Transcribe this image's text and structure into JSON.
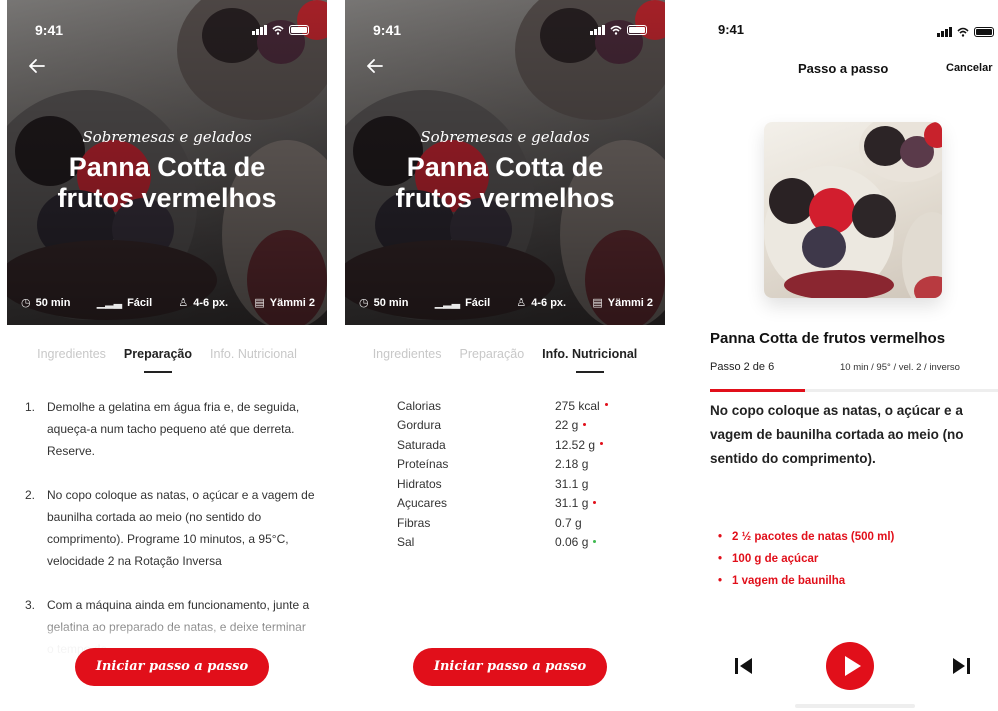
{
  "status": {
    "time": "9:41"
  },
  "recipe": {
    "category": "Sobremesas e gelados",
    "title": "Panna Cotta de frutos vermelhos",
    "title_line1": "Panna Cotta de",
    "title_line2": "frutos vermelhos",
    "meta": {
      "time": "50 min",
      "difficulty": "Fácil",
      "portions": "4-6 px.",
      "device": "Yämmi 2"
    }
  },
  "tabs": {
    "ingredients": "Ingredientes",
    "preparation": "Preparação",
    "nutrition": "Info. Nutricional"
  },
  "preparation_steps": [
    {
      "num": "1.",
      "text": "Demolhe a gelatina em água fria e, de seguida, aqueça-a num tacho pequeno até que derreta. Reserve."
    },
    {
      "num": "2.",
      "text": "No copo coloque as natas, o açúcar e a vagem de baunilha cortada ao meio (no sentido do comprimento). Programe 10 minutos, a 95°C, velocidade 2 na Rotação Inversa"
    },
    {
      "num": "3.",
      "text": "Com a máquina ainda em funcionamento, junte a gelatina ao preparado de natas, e deixe terminar o tempo de"
    }
  ],
  "nutrition": [
    {
      "label": "Calorias",
      "value": "275 kcal",
      "dot": "#e10f1a"
    },
    {
      "label": "Gordura",
      "value": "22 g",
      "dot": "#e10f1a"
    },
    {
      "label": "Saturada",
      "value": "12.52 g",
      "dot": "#e10f1a"
    },
    {
      "label": "Proteínas",
      "value": "2.18 g",
      "dot": ""
    },
    {
      "label": "Hidratos",
      "value": "31.1 g",
      "dot": ""
    },
    {
      "label": "Açucares",
      "value": "31.1 g",
      "dot": "#e10f1a"
    },
    {
      "label": "Fibras",
      "value": "0.7 g",
      "dot": ""
    },
    {
      "label": "Sal",
      "value": "0.06 g",
      "dot": "#3fb950"
    }
  ],
  "cta": "Iniciar passo a passo",
  "stepper": {
    "nav_title": "Passo a passo",
    "cancel": "Cancelar",
    "recipe_title": "Panna Cotta de frutos vermelhos",
    "step_label": "Passo 2 de 6",
    "step_info": "10 min / 95° / vel. 2 / inverso",
    "progress": 0.33,
    "instruction": "No copo coloque as natas, o açúcar e a vagem de baunilha cortada ao meio (no sentido do comprimento).",
    "ingredients": [
      "2 ½ pacotes de natas (500 ml)",
      "100 g de açúcar",
      "1 vagem de baunilha"
    ]
  },
  "colors": {
    "accent": "#e10f1a",
    "salt_dot": "#3fb950"
  },
  "icons": [
    "back-arrow-icon",
    "clock-icon",
    "difficulty-icon",
    "people-icon",
    "device-icon",
    "previous-icon",
    "play-icon",
    "next-icon"
  ]
}
